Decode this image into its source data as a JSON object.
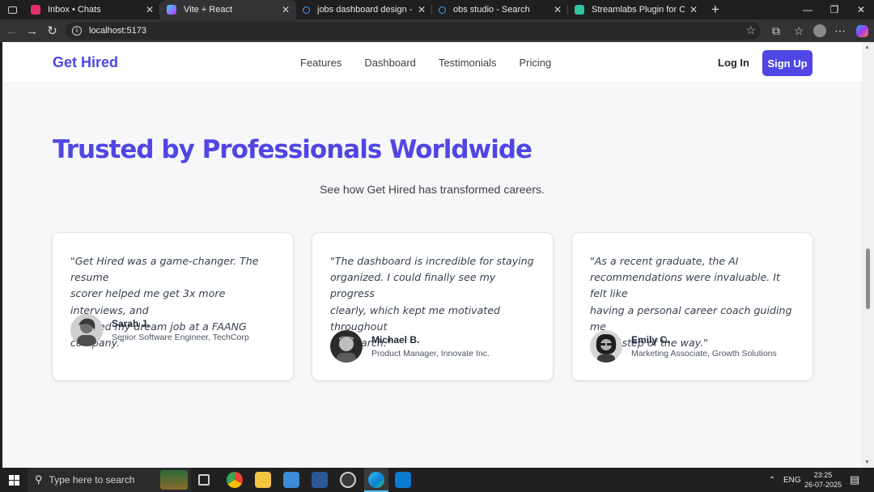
{
  "browser": {
    "tabs": [
      {
        "title": "Inbox • Chats",
        "favicon": "instagram-icon",
        "color": "#e1306c",
        "active": false
      },
      {
        "title": "Vite + React",
        "favicon": "vite-icon",
        "color": "#a855f7",
        "active": true
      },
      {
        "title": "jobs dashboard design - Search",
        "favicon": "bing-search-icon",
        "color": "#3b82f6",
        "active": false
      },
      {
        "title": "obs studio - Search",
        "favicon": "bing-search-icon",
        "color": "#3b82f6",
        "active": false
      },
      {
        "title": "Streamlabs Plugin for OBS | Add A",
        "favicon": "streamlabs-icon",
        "color": "#31c3a2",
        "active": false
      }
    ],
    "url": "localhost:5173"
  },
  "site": {
    "brand": "Get Hired",
    "nav": [
      "Features",
      "Dashboard",
      "Testimonials",
      "Pricing"
    ],
    "login": "Log In",
    "signup": "Sign Up",
    "accent": "#4f46e5"
  },
  "section": {
    "title": "Trusted by Professionals Worldwide",
    "subtitle": "See how Get Hired has transformed careers."
  },
  "testimonials": [
    {
      "quote_lines": [
        "\"Get Hired was a game-changer. The resume",
        "scorer helped me get 3x more interviews, and",
        "I landed my dream job at a FAANG company.\""
      ],
      "name": "Sarah J.",
      "role": "Senior Software Engineer, TechCorp"
    },
    {
      "quote_lines": [
        "\"The dashboard is incredible for staying",
        "organized. I could finally see my progress",
        "clearly, which kept me motivated throughout",
        "my search.\""
      ],
      "name": "Michael B.",
      "role": "Product Manager, Innovate Inc."
    },
    {
      "quote_lines": [
        "\"As a recent graduate, the AI",
        "recommendations were invaluable. It felt like",
        "having a personal career coach guiding me",
        "every step of the way.\""
      ],
      "name": "Emily C.",
      "role": "Marketing Associate, Growth Solutions"
    }
  ],
  "taskbar": {
    "search_placeholder": "Type here to search",
    "language": "ENG",
    "time": "23:25",
    "date": "26-07-2025"
  }
}
